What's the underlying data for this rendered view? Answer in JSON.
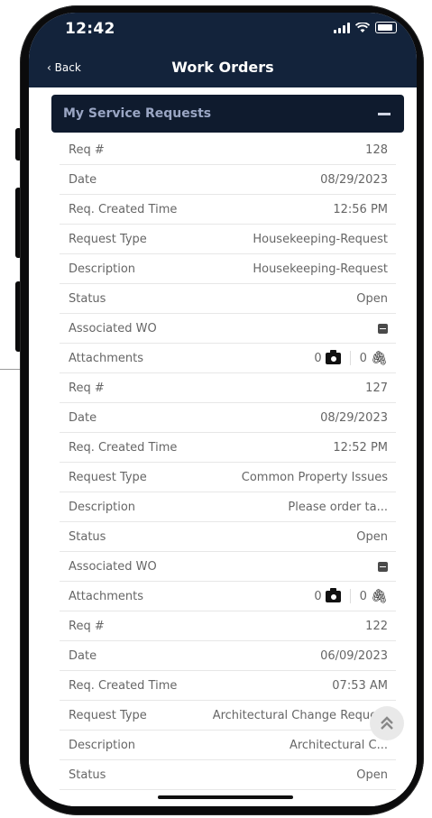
{
  "status_bar": {
    "time": "12:42"
  },
  "nav": {
    "back_label": "Back",
    "title": "Work Orders"
  },
  "section": {
    "title": "My Service Requests"
  },
  "requests": [
    {
      "req_label": "Req #",
      "req_value": "128",
      "date_label": "Date",
      "date_value": "08/29/2023",
      "time_label": "Req. Created Time",
      "time_value": "12:56 PM",
      "type_label": "Request Type",
      "type_value": "Housekeeping-Request",
      "desc_label": "Description",
      "desc_value": "Housekeeping-Request",
      "status_label": "Status",
      "status_value": "Open",
      "wo_label": "Associated WO",
      "attach_label": "Attachments",
      "photo_count": "0",
      "file_count": "0"
    },
    {
      "req_label": "Req #",
      "req_value": "127",
      "date_label": "Date",
      "date_value": "08/29/2023",
      "time_label": "Req. Created Time",
      "time_value": "12:52 PM",
      "type_label": "Request Type",
      "type_value": "Common Property Issues",
      "desc_label": "Description",
      "desc_value": "Please order ta...",
      "status_label": "Status",
      "status_value": "Open",
      "wo_label": "Associated WO",
      "attach_label": "Attachments",
      "photo_count": "0",
      "file_count": "0"
    },
    {
      "req_label": "Req #",
      "req_value": "122",
      "date_label": "Date",
      "date_value": "06/09/2023",
      "time_label": "Req. Created Time",
      "time_value": "07:53 AM",
      "type_label": "Request Type",
      "type_value": "Architectural Change Request",
      "desc_label": "Description",
      "desc_value": "Architectural C...",
      "status_label": "Status",
      "status_value": "Open"
    }
  ],
  "icons": {
    "photo": "camera-icon",
    "file": "paperclip-icon",
    "scroll_top": "double-chevron-up-icon"
  },
  "colors": {
    "header_bg": "#13233b",
    "section_bg": "#0f1b2e",
    "annotation_dot": "#c0323a"
  }
}
